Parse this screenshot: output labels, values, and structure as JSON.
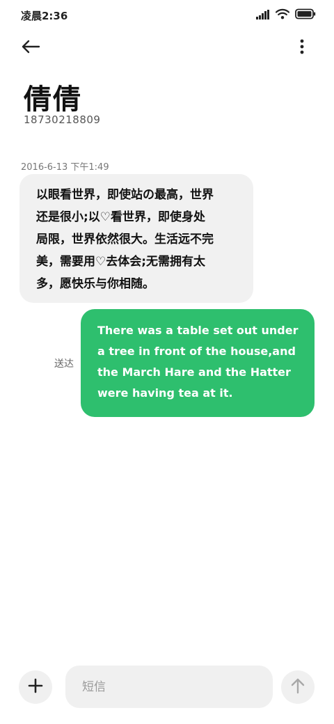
{
  "status_bar": {
    "time": "凌晨2:36",
    "icons": [
      "signal-icon",
      "wifi-icon",
      "battery-icon"
    ]
  },
  "header": {
    "back_icon": "back-arrow-icon",
    "more_icon": "more-vertical-icon",
    "contact_name": "倩倩",
    "contact_number": "18730218809"
  },
  "conversation": {
    "timestamp": "2016-6-13 下午1:49",
    "received": {
      "text": "以眼看世界，即使站の最高，世界\n还是很小;以♡看世界，即使身处\n局限，世界依然很大。生活远不完\n美，需要用♡去体会;无需拥有太\n多，愿快乐与你相随。"
    },
    "sent": {
      "status": "送达",
      "text": "There was a table set out under\na tree in front of the house,and\nthe March Hare and the Hatter\nwere having tea at it."
    }
  },
  "compose": {
    "placeholder": "短信",
    "add_icon": "plus-icon",
    "send_icon": "send-arrow-up-icon"
  },
  "colors": {
    "sent_bubble": "#2ebf6e",
    "received_bubble": "#f1f1f1",
    "compose_bg": "#f0f0f0"
  }
}
